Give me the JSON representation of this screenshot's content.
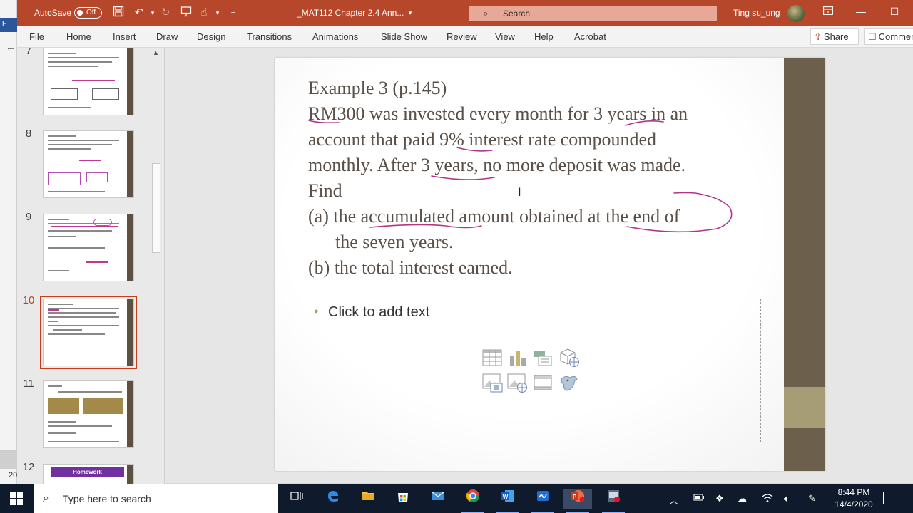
{
  "bg_app": {
    "left_number": "20"
  },
  "titlebar": {
    "autosave_label": "AutoSave",
    "autosave_state": "Off",
    "doc_title": "_MAT112 Chapter 2.4 Ann...",
    "search_placeholder": "Search",
    "user_name": "Ting su_ung"
  },
  "ribbon": {
    "tabs": [
      "File",
      "Home",
      "Insert",
      "Draw",
      "Design",
      "Transitions",
      "Animations",
      "Slide Show",
      "Review",
      "View",
      "Help",
      "Acrobat"
    ],
    "share_label": "Share",
    "comments_label": "Comments"
  },
  "thumbnails": {
    "numbers": [
      "7",
      "8",
      "9",
      "10",
      "11",
      "12"
    ],
    "active_index": 3,
    "homework_label": "Homework"
  },
  "slide": {
    "lines": [
      "Example 3 (p.145)",
      "RM300 was invested every month for 3 years in an",
      "account that paid 9% interest rate compounded",
      "monthly. After 3 years, no more deposit was made.",
      "Find",
      "(a) the accumulated amount obtained at the end of",
      "the seven years.",
      "(b) the total interest earned."
    ],
    "placeholder_text": "Click to add text",
    "accent_colors": {
      "side_bar": "#6c5f4c",
      "side_accent": "#a69d76",
      "ink": "#b0368c"
    }
  },
  "taskbar": {
    "search_placeholder": "Type here to search",
    "time": "8:44 PM",
    "date": "14/4/2020"
  }
}
